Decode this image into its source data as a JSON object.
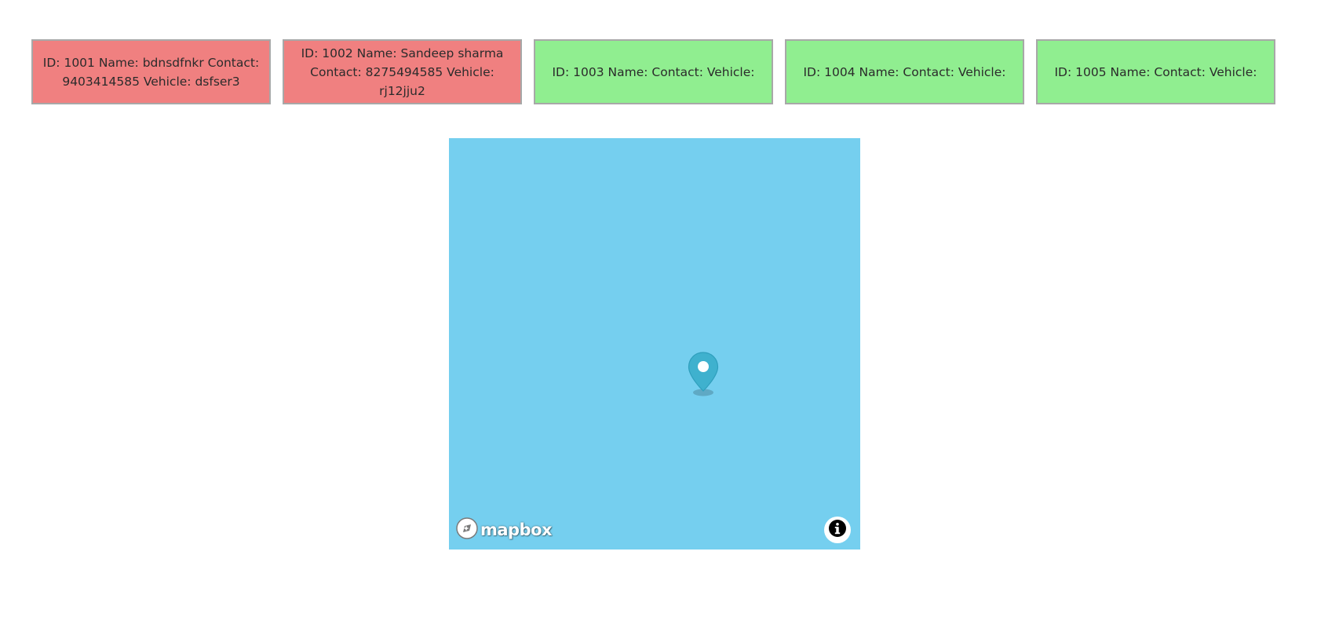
{
  "cards": [
    {
      "text": "ID: 1001 Name: bdnsdfnkr Contact: 9403414585 Vehicle: dsfser3",
      "status": "busy"
    },
    {
      "text": "ID: 1002 Name: Sandeep sharma Contact: 8275494585 Vehicle: rj12jju2",
      "status": "busy"
    },
    {
      "text": "ID: 1003 Name: Contact: Vehicle:",
      "status": "free"
    },
    {
      "text": "ID: 1004 Name: Contact: Vehicle:",
      "status": "free"
    },
    {
      "text": "ID: 1005 Name: Contact: Vehicle:",
      "status": "free"
    }
  ],
  "colors": {
    "busy": "#f08080",
    "free": "#90ee90",
    "map_water": "#75cfef",
    "marker": "#3fb1ce"
  },
  "map": {
    "logo_text": "mapbox",
    "logo_icon": "mapbox-logo-icon",
    "marker_icon": "map-pin-icon",
    "attribution_icon": "info-icon"
  }
}
